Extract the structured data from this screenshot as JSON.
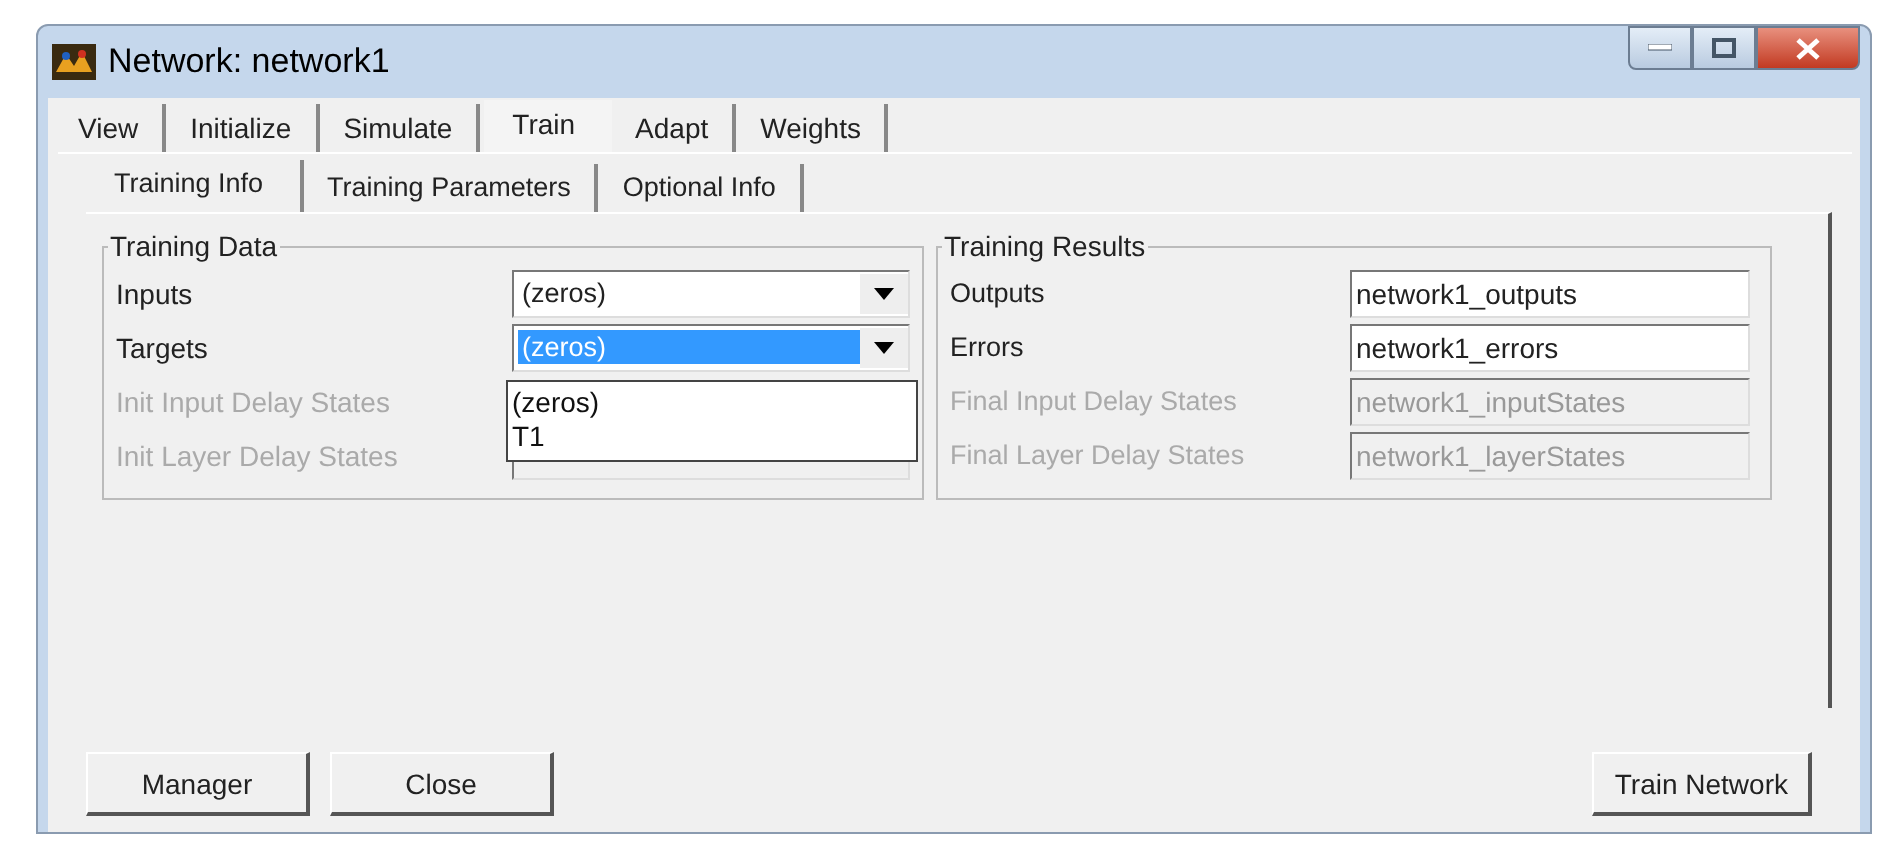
{
  "window": {
    "title": "Network: network1"
  },
  "tabs": [
    {
      "label": "View",
      "selected": false
    },
    {
      "label": "Initialize",
      "selected": false
    },
    {
      "label": "Simulate",
      "selected": false
    },
    {
      "label": "Train",
      "selected": true
    },
    {
      "label": "Adapt",
      "selected": false
    },
    {
      "label": "Weights",
      "selected": false
    }
  ],
  "subtabs": [
    {
      "label": "Training Info",
      "selected": true
    },
    {
      "label": "Training Parameters",
      "selected": false
    },
    {
      "label": "Optional Info",
      "selected": false
    }
  ],
  "training_data": {
    "title": "Training Data",
    "rows": [
      {
        "kind": "combo",
        "label": "Inputs",
        "value": "(zeros)",
        "disabled": false,
        "highlighted": false
      },
      {
        "kind": "combo",
        "label": "Targets",
        "value": "(zeros)",
        "disabled": false,
        "highlighted": true,
        "options": [
          {
            "label": "(zeros)"
          },
          {
            "label": "T1"
          }
        ]
      },
      {
        "kind": "label",
        "label": "Init Input Delay States",
        "disabled": true
      },
      {
        "kind": "combo",
        "label": "Init Layer Delay States",
        "disabled": true
      }
    ]
  },
  "training_results": {
    "title": "Training Results",
    "rows": [
      {
        "label": "Outputs",
        "value": "network1_outputs",
        "disabled": false
      },
      {
        "label": "Errors",
        "value": "network1_errors",
        "disabled": false
      },
      {
        "label": "Final Input Delay States",
        "value": "network1_inputStates",
        "disabled": true
      },
      {
        "label": "Final Layer Delay States",
        "value": "network1_layerStates",
        "disabled": true
      }
    ]
  },
  "buttons": [
    {
      "label": "Manager",
      "right_aligned": false
    },
    {
      "label": "Close",
      "right_aligned": false
    },
    {
      "label": "Train Network",
      "right_aligned": true
    }
  ]
}
